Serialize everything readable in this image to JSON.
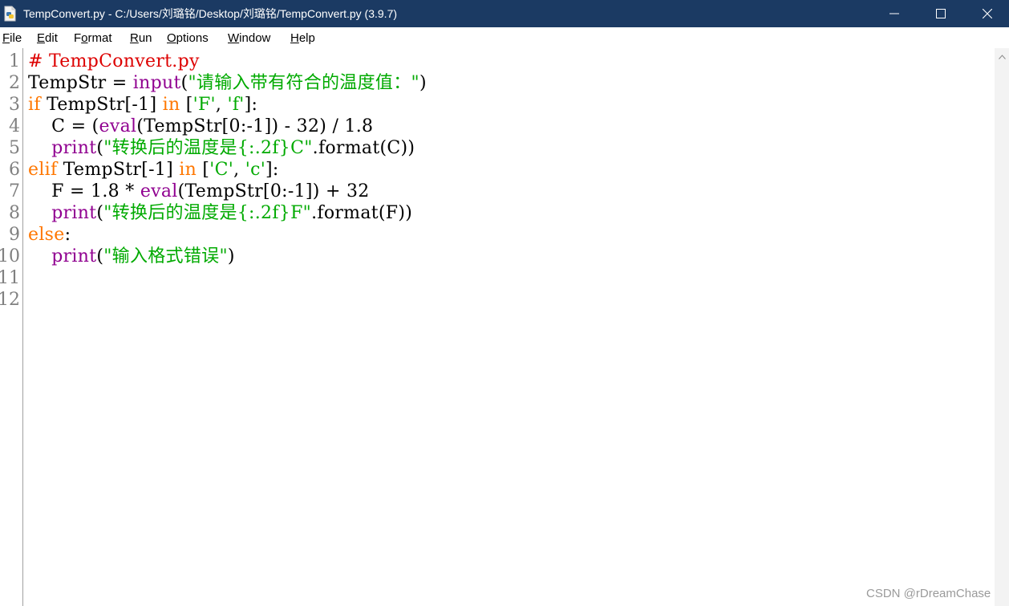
{
  "window": {
    "title": "TempConvert.py - C:/Users/刘璐铭/Desktop/刘璐铭/TempConvert.py (3.9.7)",
    "icon": "python-file-icon",
    "controls": [
      "minimize-icon",
      "maximize-icon",
      "close-icon"
    ]
  },
  "menu": [
    {
      "key": "F",
      "rest": "ile"
    },
    {
      "key": "E",
      "rest": "dit"
    },
    {
      "key": "",
      "pre": "F",
      "key2": "o",
      "rest": "rmat"
    },
    {
      "key": "R",
      "rest": "un"
    },
    {
      "key": "O",
      "rest": "ptions"
    },
    {
      "key": "W",
      "rest": "indow"
    },
    {
      "key": "H",
      "rest": "elp"
    }
  ],
  "menu_labels": {
    "file": {
      "u": "F",
      "t": "ile"
    },
    "edit": {
      "u": "E",
      "t": "dit"
    },
    "format": {
      "a": "F",
      "u": "o",
      "t": "rmat"
    },
    "run": {
      "u": "R",
      "t": "un"
    },
    "options": {
      "u": "O",
      "t": "ptions"
    },
    "window": {
      "u": "W",
      "t": "indow"
    },
    "help": {
      "u": "H",
      "t": "elp"
    }
  },
  "line_numbers": [
    "1",
    "2",
    "3",
    "4",
    "5",
    "6",
    "7",
    "8",
    "9",
    "10",
    "11",
    "12"
  ],
  "code_lines": [
    [
      {
        "t": "# TempConvert.py",
        "c": "comment"
      }
    ],
    [
      {
        "t": "TempStr = ",
        "c": "plain"
      },
      {
        "t": "input",
        "c": "builtin"
      },
      {
        "t": "(",
        "c": "plain"
      },
      {
        "t": "\"请输入带有符合的温度值：\"",
        "c": "string"
      },
      {
        "t": ")",
        "c": "plain"
      }
    ],
    [
      {
        "t": "if",
        "c": "keyword"
      },
      {
        "t": " TempStr[-1] ",
        "c": "plain"
      },
      {
        "t": "in",
        "c": "keyword"
      },
      {
        "t": " [",
        "c": "plain"
      },
      {
        "t": "'F'",
        "c": "string"
      },
      {
        "t": ", ",
        "c": "plain"
      },
      {
        "t": "'f'",
        "c": "string"
      },
      {
        "t": "]:",
        "c": "plain"
      }
    ],
    [
      {
        "t": "    C = (",
        "c": "plain"
      },
      {
        "t": "eval",
        "c": "builtin"
      },
      {
        "t": "(TempStr[0:-1]) - 32) / 1.8",
        "c": "plain"
      }
    ],
    [
      {
        "t": "    ",
        "c": "plain"
      },
      {
        "t": "print",
        "c": "builtin"
      },
      {
        "t": "(",
        "c": "plain"
      },
      {
        "t": "\"转换后的温度是{:.2f}C\"",
        "c": "string"
      },
      {
        "t": ".format(C))",
        "c": "plain"
      }
    ],
    [
      {
        "t": "elif",
        "c": "keyword"
      },
      {
        "t": " TempStr[-1] ",
        "c": "plain"
      },
      {
        "t": "in",
        "c": "keyword"
      },
      {
        "t": " [",
        "c": "plain"
      },
      {
        "t": "'C'",
        "c": "string"
      },
      {
        "t": ", ",
        "c": "plain"
      },
      {
        "t": "'c'",
        "c": "string"
      },
      {
        "t": "]:",
        "c": "plain"
      }
    ],
    [
      {
        "t": "    F = 1.8 * ",
        "c": "plain"
      },
      {
        "t": "eval",
        "c": "builtin"
      },
      {
        "t": "(TempStr[0:-1]) + 32",
        "c": "plain"
      }
    ],
    [
      {
        "t": "    ",
        "c": "plain"
      },
      {
        "t": "print",
        "c": "builtin"
      },
      {
        "t": "(",
        "c": "plain"
      },
      {
        "t": "\"转换后的温度是{:.2f}F\"",
        "c": "string"
      },
      {
        "t": ".format(F))",
        "c": "plain"
      }
    ],
    [
      {
        "t": "else",
        "c": "keyword"
      },
      {
        "t": ":",
        "c": "plain"
      }
    ],
    [
      {
        "t": "    ",
        "c": "plain"
      },
      {
        "t": "print",
        "c": "builtin"
      },
      {
        "t": "(",
        "c": "plain"
      },
      {
        "t": "\"输入格式错误\"",
        "c": "string"
      },
      {
        "t": ")",
        "c": "plain"
      }
    ],
    [],
    []
  ],
  "colors": {
    "titlebar": "#1b3a63",
    "comment": "#dd0000",
    "keyword": "#ff7700",
    "builtin": "#900090",
    "string": "#00aa00"
  },
  "watermark": "CSDN @rDreamChase"
}
